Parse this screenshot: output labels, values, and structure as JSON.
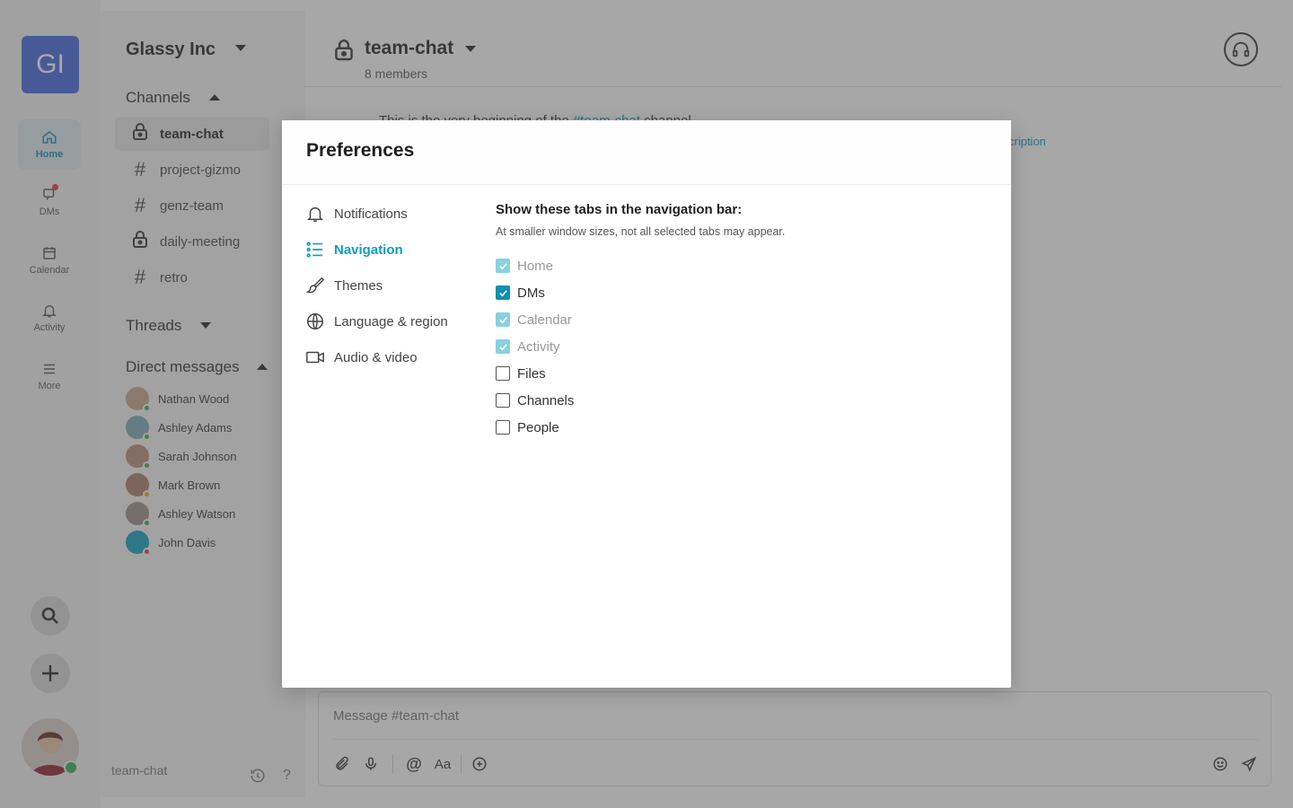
{
  "rail": {
    "workspace_initials": "GI",
    "items": [
      {
        "label": "Home",
        "icon": "home-icon"
      },
      {
        "label": "DMs",
        "icon": "chat-icon"
      },
      {
        "label": "Calendar",
        "icon": "calendar-icon"
      },
      {
        "label": "Activity",
        "icon": "bell-icon"
      },
      {
        "label": "More",
        "icon": "menu-icon"
      }
    ]
  },
  "sidebar": {
    "workspace_name": "Glassy Inc",
    "channels_title": "Channels",
    "channels": [
      {
        "name": "team-chat",
        "type": "private"
      },
      {
        "name": "project-gizmo",
        "type": "public"
      },
      {
        "name": "genz-team",
        "type": "public"
      },
      {
        "name": "daily-meeting",
        "type": "private"
      },
      {
        "name": "retro",
        "type": "public"
      }
    ],
    "threads_title": "Threads",
    "dms_title": "Direct messages",
    "dms": [
      {
        "name": "Nathan Wood",
        "status_color": "#2bb24c"
      },
      {
        "name": "Ashley Adams",
        "status_color": "#2bb24c"
      },
      {
        "name": "Sarah Johnson",
        "status_color": "#2bb24c"
      },
      {
        "name": "Mark Brown",
        "status_color": "#f0a020"
      },
      {
        "name": "Ashley Watson",
        "status_color": "#2bb24c"
      },
      {
        "name": "John Davis",
        "status_color": "#e0393c"
      }
    ],
    "footer_channel": "team-chat",
    "footer_help": "?"
  },
  "main": {
    "channel_name": "team-chat",
    "members": "8 members",
    "intro_prefix": "This is the very beginning of the ",
    "intro_channel": "#team-chat",
    "intro_suffix": " channel",
    "desc_link": "cription",
    "composer_placeholder": "Message #team-chat",
    "format_label": "Aa"
  },
  "modal": {
    "title": "Preferences",
    "menu": [
      {
        "label": "Notifications",
        "icon": "bell-icon"
      },
      {
        "label": "Navigation",
        "icon": "list-icon",
        "active": true
      },
      {
        "label": "Themes",
        "icon": "brush-icon"
      },
      {
        "label": "Language & region",
        "icon": "globe-icon"
      },
      {
        "label": "Audio & video",
        "icon": "video-icon"
      }
    ],
    "heading": "Show these tabs in the navigation bar:",
    "subtext": "At smaller window sizes, not all selected tabs may appear.",
    "options": [
      {
        "label": "Home",
        "checked": true,
        "disabled": true
      },
      {
        "label": "DMs",
        "checked": true,
        "disabled": false
      },
      {
        "label": "Calendar",
        "checked": true,
        "disabled": true
      },
      {
        "label": "Activity",
        "checked": true,
        "disabled": true
      },
      {
        "label": "Files",
        "checked": false,
        "disabled": false
      },
      {
        "label": "Channels",
        "checked": false,
        "disabled": false
      },
      {
        "label": "People",
        "checked": false,
        "disabled": false
      }
    ]
  },
  "colors": {
    "accent": "#0c8fb0",
    "brand": "#4063e0",
    "online": "#2bb24c"
  }
}
